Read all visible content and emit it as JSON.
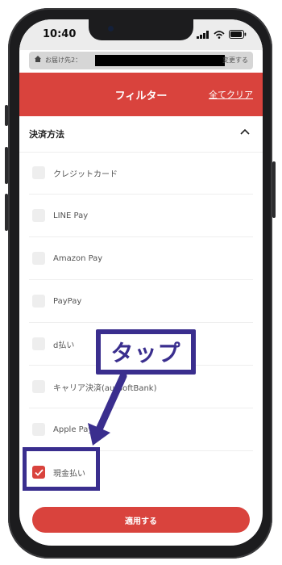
{
  "status": {
    "time": "10:40"
  },
  "address_bar": {
    "prefix": "お届け先2：",
    "change_label": "変更する"
  },
  "filter_header": {
    "title": "フィルター",
    "clear_all": "全てクリア"
  },
  "section": {
    "title": "決済方法"
  },
  "payment_options": [
    {
      "label": "クレジットカード",
      "checked": false
    },
    {
      "label": "LINE Pay",
      "checked": false
    },
    {
      "label": "Amazon Pay",
      "checked": false
    },
    {
      "label": "PayPay",
      "checked": false
    },
    {
      "label": "d払い",
      "checked": false
    },
    {
      "label": "キャリア決済(au/SoftBank)",
      "checked": false
    },
    {
      "label": "Apple Pay",
      "checked": false
    },
    {
      "label": "現金払い",
      "checked": true
    }
  ],
  "apply_button": {
    "label": "適用する"
  },
  "annotation": {
    "text": "タップ"
  },
  "colors": {
    "accent": "#d9433d",
    "annotation": "#3a2e8e"
  }
}
